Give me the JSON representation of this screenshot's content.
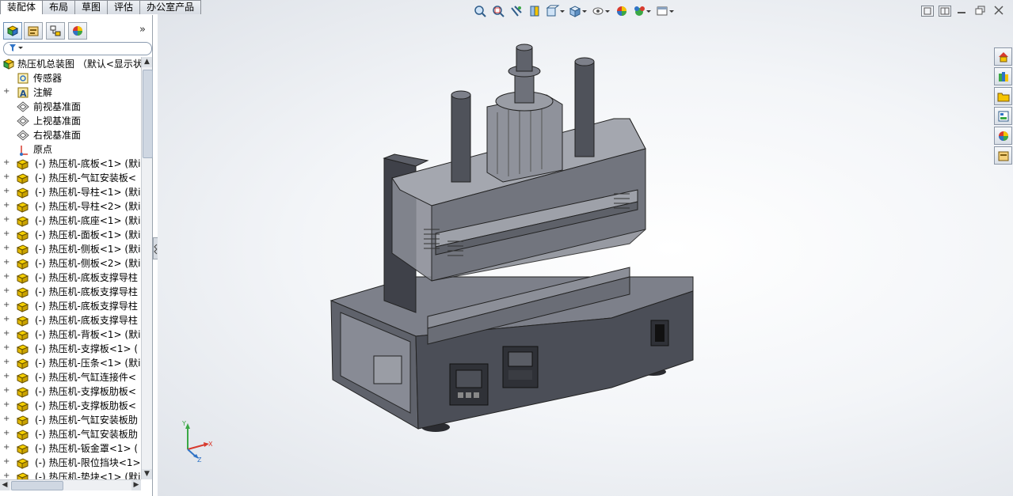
{
  "tabs": [
    {
      "label": "装配体",
      "active": true
    },
    {
      "label": "布局",
      "active": false
    },
    {
      "label": "草图",
      "active": false
    },
    {
      "label": "评估",
      "active": false
    },
    {
      "label": "办公室产品",
      "active": false
    }
  ],
  "panel": {
    "icons": [
      "feature-manager-icon",
      "property-manager-icon",
      "configuration-manager-icon",
      "display-manager-icon"
    ],
    "expand_glyph": "»"
  },
  "tree": {
    "root": "热压机总装图 （默认<显示状",
    "items": [
      {
        "label": "传感器",
        "icon": "sensor-icon",
        "expand": false
      },
      {
        "label": "注解",
        "icon": "annotation-icon",
        "expand": true
      },
      {
        "label": "前视基准面",
        "icon": "plane-icon",
        "expand": false
      },
      {
        "label": "上视基准面",
        "icon": "plane-icon",
        "expand": false
      },
      {
        "label": "右视基准面",
        "icon": "plane-icon",
        "expand": false
      },
      {
        "label": "原点",
        "icon": "origin-icon",
        "expand": false
      },
      {
        "label": "(-) 热压机-底板<1> (默i",
        "icon": "part-icon",
        "expand": true
      },
      {
        "label": "(-) 热压机-气缸安装板<",
        "icon": "part-icon",
        "expand": true
      },
      {
        "label": "(-) 热压机-导柱<1> (默i",
        "icon": "part-icon",
        "expand": true
      },
      {
        "label": "(-) 热压机-导柱<2> (默i",
        "icon": "part-icon",
        "expand": true
      },
      {
        "label": "(-) 热压机-底座<1> (默i",
        "icon": "part-icon",
        "expand": true
      },
      {
        "label": "(-) 热压机-面板<1> (默i",
        "icon": "part-icon",
        "expand": true
      },
      {
        "label": "(-) 热压机-侧板<1> (默i",
        "icon": "part-icon",
        "expand": true
      },
      {
        "label": "(-) 热压机-侧板<2> (默i",
        "icon": "part-icon",
        "expand": true
      },
      {
        "label": "(-) 热压机-底板支撑导柱",
        "icon": "part-icon",
        "expand": true
      },
      {
        "label": "(-) 热压机-底板支撑导柱",
        "icon": "part-icon",
        "expand": true
      },
      {
        "label": "(-) 热压机-底板支撑导柱",
        "icon": "part-icon",
        "expand": true
      },
      {
        "label": "(-) 热压机-底板支撑导柱",
        "icon": "part-icon",
        "expand": true
      },
      {
        "label": "(-) 热压机-背板<1> (默i",
        "icon": "part-icon",
        "expand": true
      },
      {
        "label": "(-) 热压机-支撑板<1> (",
        "icon": "part-icon",
        "expand": true
      },
      {
        "label": "(-) 热压机-压条<1> (默i",
        "icon": "part-icon",
        "expand": true
      },
      {
        "label": "(-) 热压机-气缸连接件<",
        "icon": "part-icon",
        "expand": true
      },
      {
        "label": "(-) 热压机-支撑板肋板<",
        "icon": "part-icon",
        "expand": true
      },
      {
        "label": "(-) 热压机-支撑板肋板<",
        "icon": "part-icon",
        "expand": true
      },
      {
        "label": "(-) 热压机-气缸安装板肋",
        "icon": "part-icon",
        "expand": true
      },
      {
        "label": "(-) 热压机-气缸安装板肋",
        "icon": "part-icon",
        "expand": true
      },
      {
        "label": "(-) 热压机-钣金罩<1> (",
        "icon": "part-icon",
        "expand": true
      },
      {
        "label": "(-) 热压机-限位挡块<1>",
        "icon": "part-icon",
        "expand": true
      },
      {
        "label": "(-) 热压机-垫块<1> (默i",
        "icon": "part-icon",
        "expand": true
      }
    ]
  },
  "hud_icons": [
    "zoom-to-fit-icon",
    "zoom-area-icon",
    "previous-view-icon",
    "section-view-icon",
    "view-orientation-icon",
    "display-style-icon",
    "hide-show-icon",
    "edit-appearance-icon",
    "apply-scene-icon",
    "view-settings-icon"
  ],
  "window_controls": [
    "tile-horizontal-icon",
    "tile-vertical-icon",
    "minimize-icon",
    "restore-icon",
    "close-icon"
  ],
  "task_pane": [
    "home-icon",
    "design-library-icon",
    "file-explorer-icon",
    "view-palette-icon",
    "appearances-icon",
    "custom-properties-icon"
  ],
  "triad": {
    "x": "X",
    "y": "Y",
    "z": "Z"
  },
  "colors": {
    "body": "#5b5e66",
    "body_dark": "#3e4048",
    "glass": "#8a8d96",
    "accent": "#2f73c6"
  }
}
